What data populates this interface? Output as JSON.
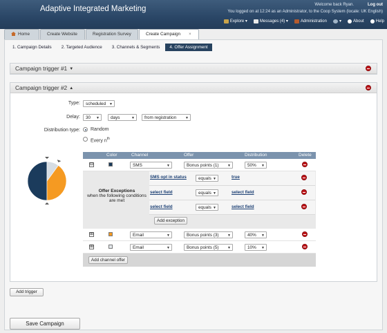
{
  "app": {
    "brand": "Adaptive Integrated Marketing",
    "welcome": "Welcome back Ryan.",
    "logout": "Log out",
    "session": "You  logged on at 12:24 as an Administrator, to the Coop System (locale: UK English)"
  },
  "toolbar": {
    "explore": "Explore ▾",
    "messages": "Messages (4) ▾",
    "administration": "Administration",
    "network": "▾",
    "about": "About",
    "help": "Help"
  },
  "tabs": [
    {
      "label": "Home"
    },
    {
      "label": "Create Website"
    },
    {
      "label": "Registration Survey"
    },
    {
      "label": "Create Campaign",
      "close": "×"
    }
  ],
  "steps": [
    {
      "label": "1. Campaign Details"
    },
    {
      "label": "2. Targeted Audience"
    },
    {
      "label": "3. Channels & Segments"
    },
    {
      "label": "4. Offer Assignment"
    }
  ],
  "trigger1": {
    "title": "Campaign trigger #1",
    "caret": "▼"
  },
  "trigger2": {
    "title": "Campaign trigger #2",
    "caret": "▲",
    "type_label": "Type:",
    "type_value": "scheduled",
    "delay_label": "Delay:",
    "delay_value": "30",
    "delay_unit": "days",
    "delay_from": "from registration",
    "dist_label": "Distribution type:",
    "dist_random": "Random",
    "dist_every": "Every n",
    "dist_every_sup": "th"
  },
  "pie": {
    "segments": [
      {
        "label": "SMS",
        "value": 50,
        "color": "#1b3b5c"
      },
      {
        "label": "Email (Bonus points 3)",
        "value": 40,
        "color": "#f59a22"
      },
      {
        "label": "Email (Bonus points 5)",
        "value": 10,
        "color": "#d6dde4"
      }
    ]
  },
  "grid": {
    "headers": {
      "color": "Color",
      "channel": "Channel",
      "offer": "Offer",
      "distribution": "Distribution",
      "delete": "Delete"
    },
    "rows": [
      {
        "toggle": "⊟",
        "color": "#1b3b5c",
        "channel": "SMS",
        "offer": "Bonus points (1)",
        "distribution": "50%"
      },
      {
        "toggle": "⊞",
        "color": "#f59a22",
        "channel": "Email",
        "offer": "Bonus points (3)",
        "distribution": "40%"
      },
      {
        "toggle": "⊞",
        "color": "#e4e8ec",
        "channel": "Email",
        "offer": "Bonus points (5)",
        "distribution": "10%"
      }
    ],
    "exceptions": {
      "title": "Offer Exceptions",
      "subtitle": "when the following conditions are met",
      "conditions": [
        {
          "field": "SMS opt in status",
          "op": "equals",
          "value": "true"
        },
        {
          "field": "select field",
          "op": "equals",
          "value": "select field"
        },
        {
          "field": "select field",
          "op": "equals",
          "value": "select field"
        }
      ],
      "add_button": "Add exception"
    },
    "add_channel_button": "Add channel offer"
  },
  "add_trigger_button": "Add trigger",
  "save_button": "Save Campaign",
  "colors": {
    "header": "#2a4666",
    "accent": "#f59a22",
    "delete": "#c0161a",
    "grid_head": "#7b93ad"
  }
}
